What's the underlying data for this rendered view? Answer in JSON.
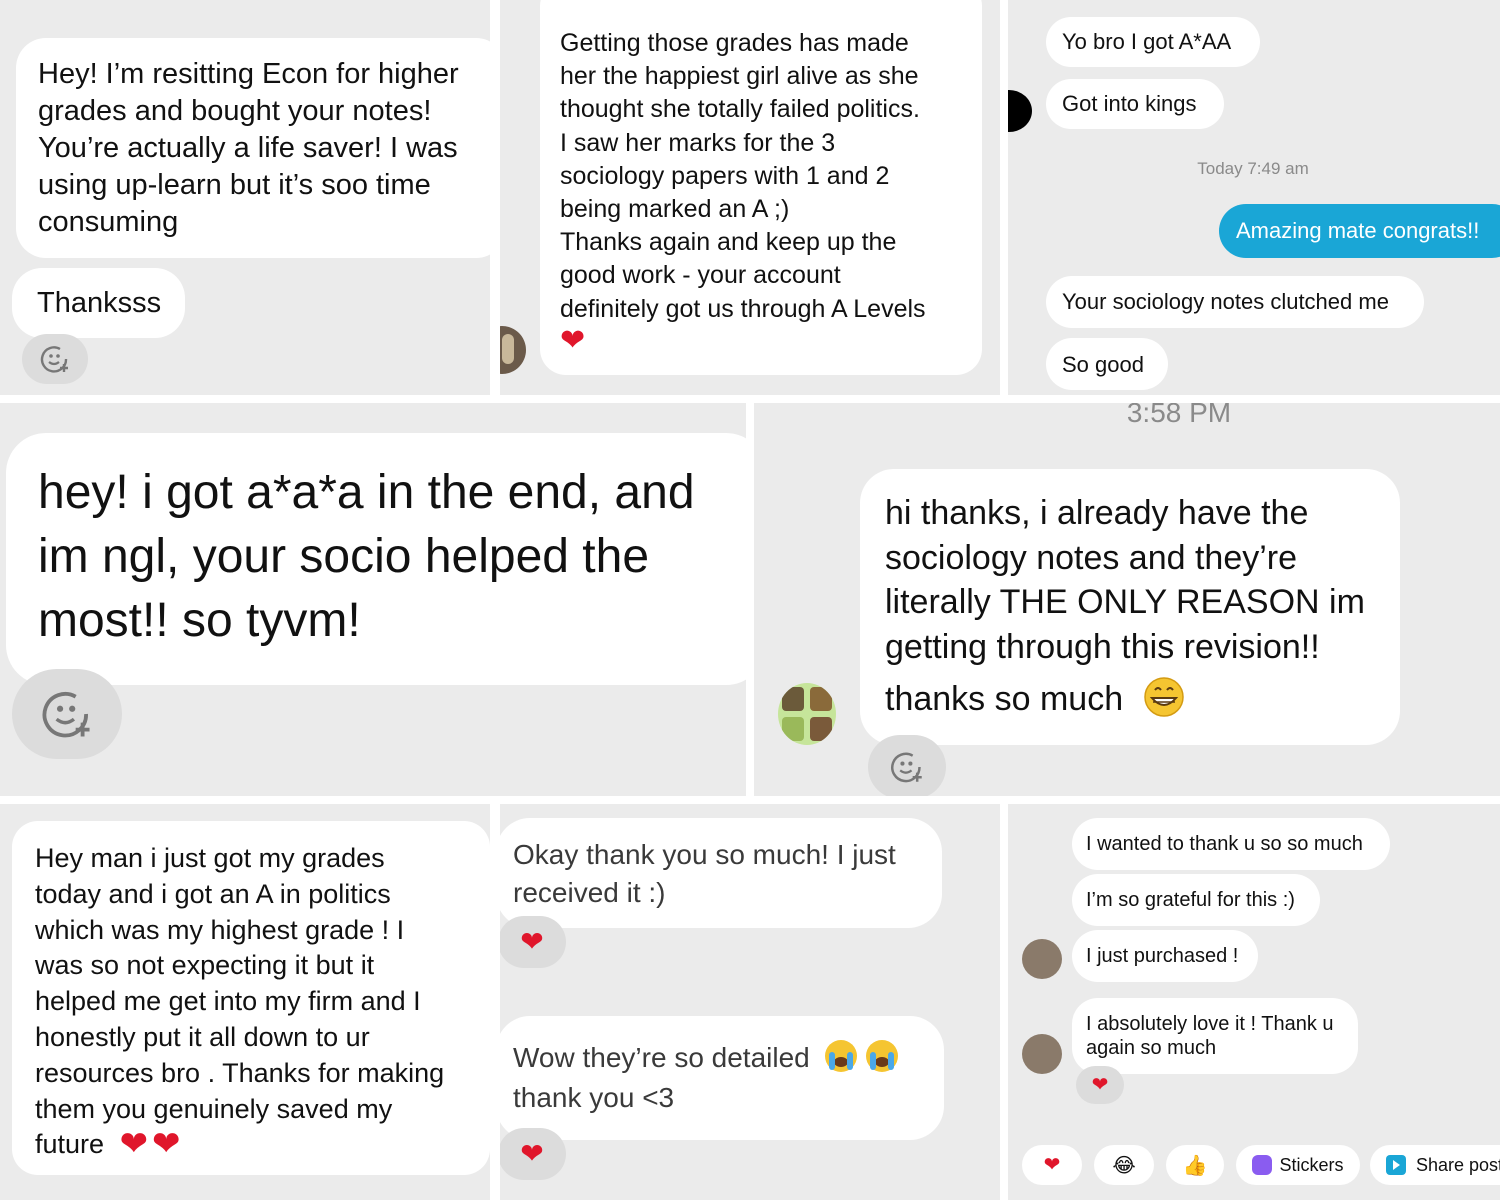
{
  "colors": {
    "panel_bg": "#ebebeb",
    "bubble_bg": "#ffffff",
    "accent_blue": "#1aa6d6",
    "heart": "#e0162b",
    "text": "#111111",
    "meta": "#8a8a8a"
  },
  "p1": {
    "message": "Hey! I’m resitting Econ for higher\ngrades and bought your notes!\nYou’re actually a life saver! I was\nusing up-learn but it’s soo time\nconsuming",
    "message2": "Thanksss",
    "react_icon": "add-reaction-icon"
  },
  "p2": {
    "message": "Getting those grades has made\nher the happiest girl alive as she\nthought she totally failed politics.\nI saw her marks for the 3\nsociology papers with 1 and 2\nbeing marked an A ;)\nThanks again and keep up the\ngood work - your account\ndefinitely got us through A Levels",
    "heart": "❤"
  },
  "p3": {
    "msg1": "Yo bro I got A*AA",
    "msg2": "Got into kings",
    "timestamp": "Today 7:49 am",
    "sent": "Amazing mate congrats!!",
    "msg3": "Your sociology notes clutched me",
    "msg4": "So good"
  },
  "p4": {
    "message": "hey! i got a*a*a in the end, and\nim ngl, your socio helped the\nmost!! so tyvm!",
    "react_icon": "add-reaction-icon"
  },
  "p5": {
    "time": "3:58 PM",
    "message": "hi thanks, i already have the\nsociology notes and they’re\nliterally THE ONLY REASON im\ngetting through this revision!!",
    "message_last": "thanks so much",
    "emoji": "grinning-face-emoji"
  },
  "p6": {
    "message": "Hey man i just got my grades\ntoday and i got an A in politics\nwhich was my highest grade ! I\nwas so not expecting it but it\nhelped me get into my firm and I\nhonestly put it all down to ur\nresources bro . Thanks for making\nthem you genuinely saved my\nfuture",
    "hearts": "❤❤"
  },
  "p7": {
    "msg1": "Okay thank you so much! I just\nreceived it :)",
    "msg2a": "Wow they’re so detailed",
    "msg2b": "thank you <3",
    "emoji": "loudly-crying-face-emoji",
    "heart": "❤"
  },
  "p8": {
    "msg1": "I wanted to thank u so so much",
    "msg2": "I’m so grateful for this :)",
    "msg3": "I just purchased !",
    "msg4": "I absolutely love it ! Thank u\nagain so much",
    "heart": "❤",
    "quick_reactions": {
      "heart": "❤",
      "laugh": "😂",
      "thumbs": "👍",
      "stickers": "Stickers",
      "share": "Share post"
    }
  }
}
